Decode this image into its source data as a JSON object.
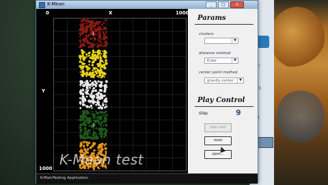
{
  "window": {
    "title": "K-Mean",
    "controls": [
      "_",
      "□",
      "x"
    ]
  },
  "canvas": {
    "x_start": "0",
    "x_label": "X",
    "x_end": "1000",
    "y_label": "Y",
    "y_end": "1000",
    "watermark": "K-Mean test"
  },
  "clusters": [
    {
      "label": "1",
      "color": "#8b1a12"
    },
    {
      "label": "",
      "color": "#e6d21e"
    },
    {
      "label": "",
      "color": "#e8e8e8"
    },
    {
      "label": "3",
      "color": "#1f5a18"
    },
    {
      "label": "",
      "color": "#e8951c"
    }
  ],
  "params": {
    "title": "Params",
    "clusters_label": "clusters",
    "clusters_value": "",
    "distance_label": "distance method",
    "distance_value": "Euler",
    "center_label": "center point method",
    "center_value": "gravity center"
  },
  "play": {
    "title": "Play Control",
    "step_label": "step",
    "step_value": "9",
    "next_label": "step next",
    "reset_label": "reset",
    "open_label": "open..."
  },
  "status": {
    "text": "K-MainTesting Application"
  },
  "desktop": {
    "behind_items": [
      "T:",
      "FI",
      "x"
    ]
  }
}
